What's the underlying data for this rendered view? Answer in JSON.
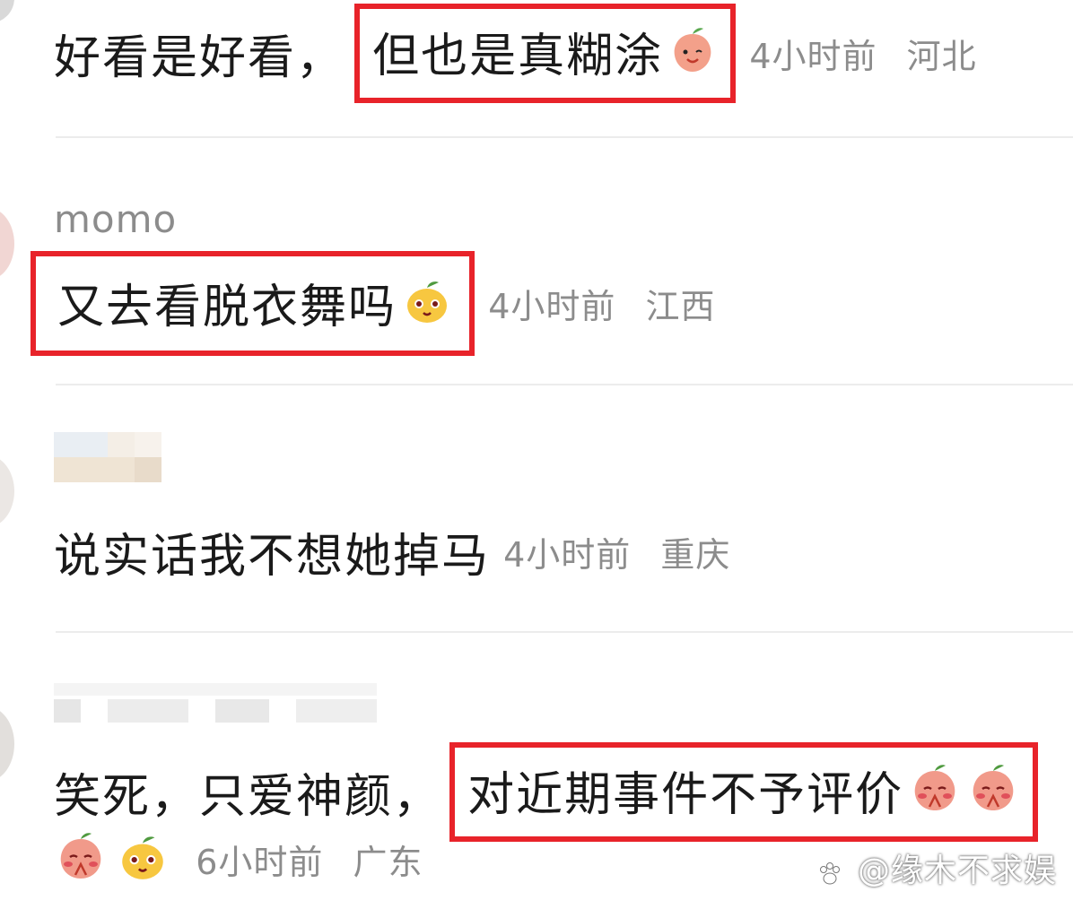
{
  "comments": [
    {
      "text_plain": "好看是好看，",
      "text_highlight": "但也是真糊涂",
      "time": "4小时前",
      "location": "河北"
    },
    {
      "username": "momo",
      "text_highlight": "又去看脱衣舞吗",
      "time": "4小时前",
      "location": "江西"
    },
    {
      "text_plain": "说实话我不想她掉马",
      "time": "4小时前",
      "location": "重庆"
    },
    {
      "text_plain": "笑死，只爱神颜，",
      "text_highlight": "对近期事件不予评价",
      "time": "6小时前",
      "location": "广东"
    }
  ],
  "watermark": "@缘木不求娱",
  "colors": {
    "highlight_border": "#e8232a",
    "text": "#1a1a1a",
    "meta": "#8c8c8c",
    "divider": "#ececec"
  },
  "icons": [
    "peach-smile-emoji",
    "lemon-face-emoji",
    "peach-pray-emoji"
  ]
}
